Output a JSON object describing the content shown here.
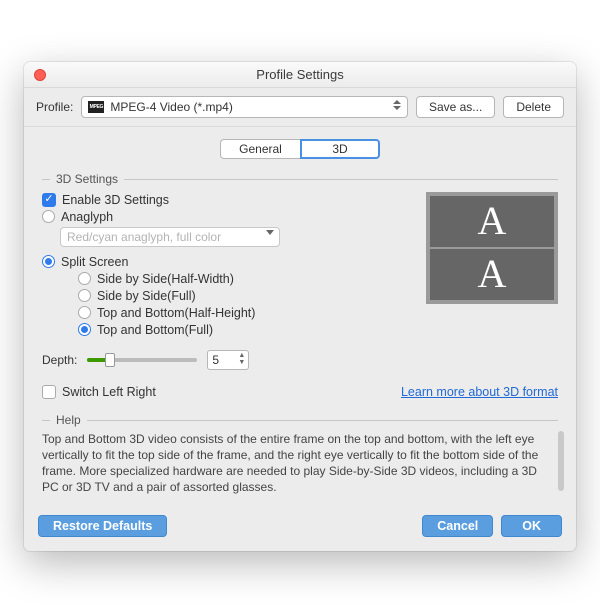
{
  "window": {
    "title": "Profile Settings"
  },
  "toolbar": {
    "profile_label": "Profile:",
    "profile_value": "MPEG-4 Video (*.mp4)",
    "save_as": "Save as...",
    "delete": "Delete"
  },
  "tabs": {
    "general": "General",
    "threeD": "3D",
    "active": "3D"
  },
  "settings3d": {
    "legend": "3D Settings",
    "enable_label": "Enable 3D Settings",
    "enable_checked": true,
    "anaglyph_label": "Anaglyph",
    "anaglyph_selected": false,
    "anaglyph_mode": "Red/cyan anaglyph, full color",
    "split_label": "Split Screen",
    "split_selected": true,
    "modes": {
      "sbs_half": "Side by Side(Half-Width)",
      "sbs_full": "Side by Side(Full)",
      "tab_half": "Top and Bottom(Half-Height)",
      "tab_full": "Top and Bottom(Full)"
    },
    "selected_mode": "tab_full",
    "depth_label": "Depth:",
    "depth_value": "5",
    "switch_label": "Switch Left Right",
    "switch_checked": false,
    "learn_more": "Learn more about 3D format"
  },
  "help": {
    "legend": "Help",
    "text": "Top and Bottom 3D video consists of the entire frame on the top and bottom, with the left eye vertically to fit the top side of the frame, and the right eye vertically to fit the bottom side of the frame. More specialized hardware are needed to play Side-by-Side 3D videos, including a 3D PC or 3D TV and a pair of assorted glasses."
  },
  "footer": {
    "restore": "Restore Defaults",
    "cancel": "Cancel",
    "ok": "OK"
  }
}
